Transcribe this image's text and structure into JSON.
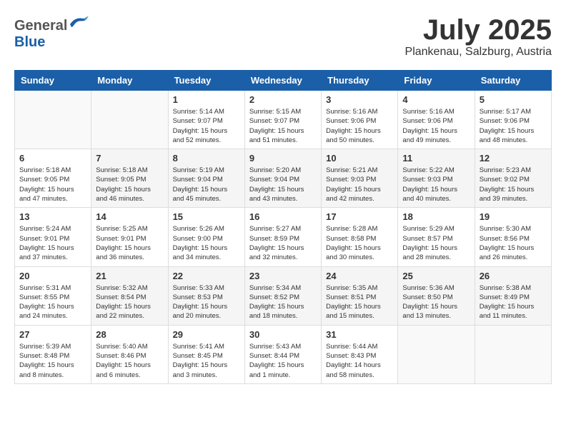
{
  "header": {
    "logo_general": "General",
    "logo_blue": "Blue",
    "month_title": "July 2025",
    "location": "Plankenau, Salzburg, Austria"
  },
  "calendar": {
    "days_of_week": [
      "Sunday",
      "Monday",
      "Tuesday",
      "Wednesday",
      "Thursday",
      "Friday",
      "Saturday"
    ],
    "weeks": [
      [
        {
          "day": "",
          "info": ""
        },
        {
          "day": "",
          "info": ""
        },
        {
          "day": "1",
          "info": "Sunrise: 5:14 AM\nSunset: 9:07 PM\nDaylight: 15 hours and 52 minutes."
        },
        {
          "day": "2",
          "info": "Sunrise: 5:15 AM\nSunset: 9:07 PM\nDaylight: 15 hours and 51 minutes."
        },
        {
          "day": "3",
          "info": "Sunrise: 5:16 AM\nSunset: 9:06 PM\nDaylight: 15 hours and 50 minutes."
        },
        {
          "day": "4",
          "info": "Sunrise: 5:16 AM\nSunset: 9:06 PM\nDaylight: 15 hours and 49 minutes."
        },
        {
          "day": "5",
          "info": "Sunrise: 5:17 AM\nSunset: 9:06 PM\nDaylight: 15 hours and 48 minutes."
        }
      ],
      [
        {
          "day": "6",
          "info": "Sunrise: 5:18 AM\nSunset: 9:05 PM\nDaylight: 15 hours and 47 minutes."
        },
        {
          "day": "7",
          "info": "Sunrise: 5:18 AM\nSunset: 9:05 PM\nDaylight: 15 hours and 46 minutes."
        },
        {
          "day": "8",
          "info": "Sunrise: 5:19 AM\nSunset: 9:04 PM\nDaylight: 15 hours and 45 minutes."
        },
        {
          "day": "9",
          "info": "Sunrise: 5:20 AM\nSunset: 9:04 PM\nDaylight: 15 hours and 43 minutes."
        },
        {
          "day": "10",
          "info": "Sunrise: 5:21 AM\nSunset: 9:03 PM\nDaylight: 15 hours and 42 minutes."
        },
        {
          "day": "11",
          "info": "Sunrise: 5:22 AM\nSunset: 9:03 PM\nDaylight: 15 hours and 40 minutes."
        },
        {
          "day": "12",
          "info": "Sunrise: 5:23 AM\nSunset: 9:02 PM\nDaylight: 15 hours and 39 minutes."
        }
      ],
      [
        {
          "day": "13",
          "info": "Sunrise: 5:24 AM\nSunset: 9:01 PM\nDaylight: 15 hours and 37 minutes."
        },
        {
          "day": "14",
          "info": "Sunrise: 5:25 AM\nSunset: 9:01 PM\nDaylight: 15 hours and 36 minutes."
        },
        {
          "day": "15",
          "info": "Sunrise: 5:26 AM\nSunset: 9:00 PM\nDaylight: 15 hours and 34 minutes."
        },
        {
          "day": "16",
          "info": "Sunrise: 5:27 AM\nSunset: 8:59 PM\nDaylight: 15 hours and 32 minutes."
        },
        {
          "day": "17",
          "info": "Sunrise: 5:28 AM\nSunset: 8:58 PM\nDaylight: 15 hours and 30 minutes."
        },
        {
          "day": "18",
          "info": "Sunrise: 5:29 AM\nSunset: 8:57 PM\nDaylight: 15 hours and 28 minutes."
        },
        {
          "day": "19",
          "info": "Sunrise: 5:30 AM\nSunset: 8:56 PM\nDaylight: 15 hours and 26 minutes."
        }
      ],
      [
        {
          "day": "20",
          "info": "Sunrise: 5:31 AM\nSunset: 8:55 PM\nDaylight: 15 hours and 24 minutes."
        },
        {
          "day": "21",
          "info": "Sunrise: 5:32 AM\nSunset: 8:54 PM\nDaylight: 15 hours and 22 minutes."
        },
        {
          "day": "22",
          "info": "Sunrise: 5:33 AM\nSunset: 8:53 PM\nDaylight: 15 hours and 20 minutes."
        },
        {
          "day": "23",
          "info": "Sunrise: 5:34 AM\nSunset: 8:52 PM\nDaylight: 15 hours and 18 minutes."
        },
        {
          "day": "24",
          "info": "Sunrise: 5:35 AM\nSunset: 8:51 PM\nDaylight: 15 hours and 15 minutes."
        },
        {
          "day": "25",
          "info": "Sunrise: 5:36 AM\nSunset: 8:50 PM\nDaylight: 15 hours and 13 minutes."
        },
        {
          "day": "26",
          "info": "Sunrise: 5:38 AM\nSunset: 8:49 PM\nDaylight: 15 hours and 11 minutes."
        }
      ],
      [
        {
          "day": "27",
          "info": "Sunrise: 5:39 AM\nSunset: 8:48 PM\nDaylight: 15 hours and 8 minutes."
        },
        {
          "day": "28",
          "info": "Sunrise: 5:40 AM\nSunset: 8:46 PM\nDaylight: 15 hours and 6 minutes."
        },
        {
          "day": "29",
          "info": "Sunrise: 5:41 AM\nSunset: 8:45 PM\nDaylight: 15 hours and 3 minutes."
        },
        {
          "day": "30",
          "info": "Sunrise: 5:43 AM\nSunset: 8:44 PM\nDaylight: 15 hours and 1 minute."
        },
        {
          "day": "31",
          "info": "Sunrise: 5:44 AM\nSunset: 8:43 PM\nDaylight: 14 hours and 58 minutes."
        },
        {
          "day": "",
          "info": ""
        },
        {
          "day": "",
          "info": ""
        }
      ]
    ]
  }
}
